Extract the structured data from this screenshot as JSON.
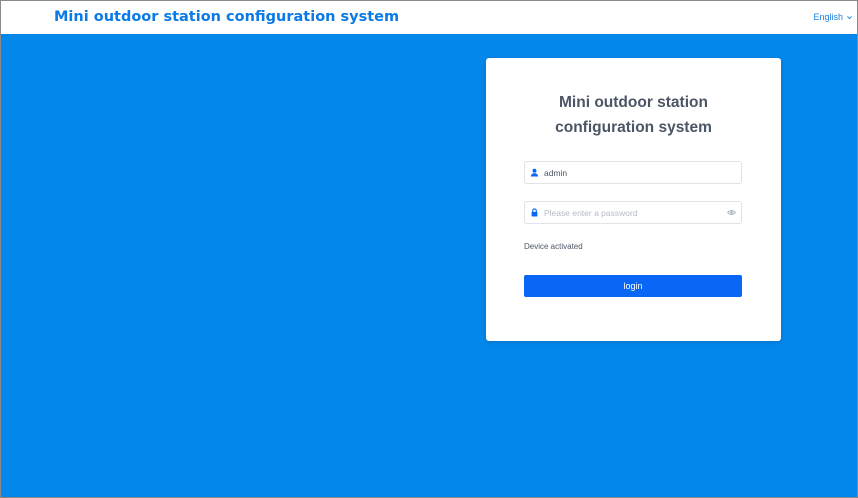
{
  "header": {
    "title": "Mini outdoor station configuration system",
    "language": "English",
    "language_icon": "chevron-down-icon"
  },
  "login_card": {
    "title_line1": "Mini outdoor station",
    "title_line2": "configuration system",
    "username": {
      "value": "admin",
      "icon": "user-icon"
    },
    "password": {
      "value": "",
      "placeholder": "Please enter a password",
      "icon": "lock-icon",
      "toggle_icon": "eye-icon"
    },
    "status": "Device activated",
    "login_label": "login"
  },
  "colors": {
    "background": "#0487ea",
    "accent": "#0a7ae6",
    "button": "#0a66f5",
    "text": "#4c5566"
  }
}
